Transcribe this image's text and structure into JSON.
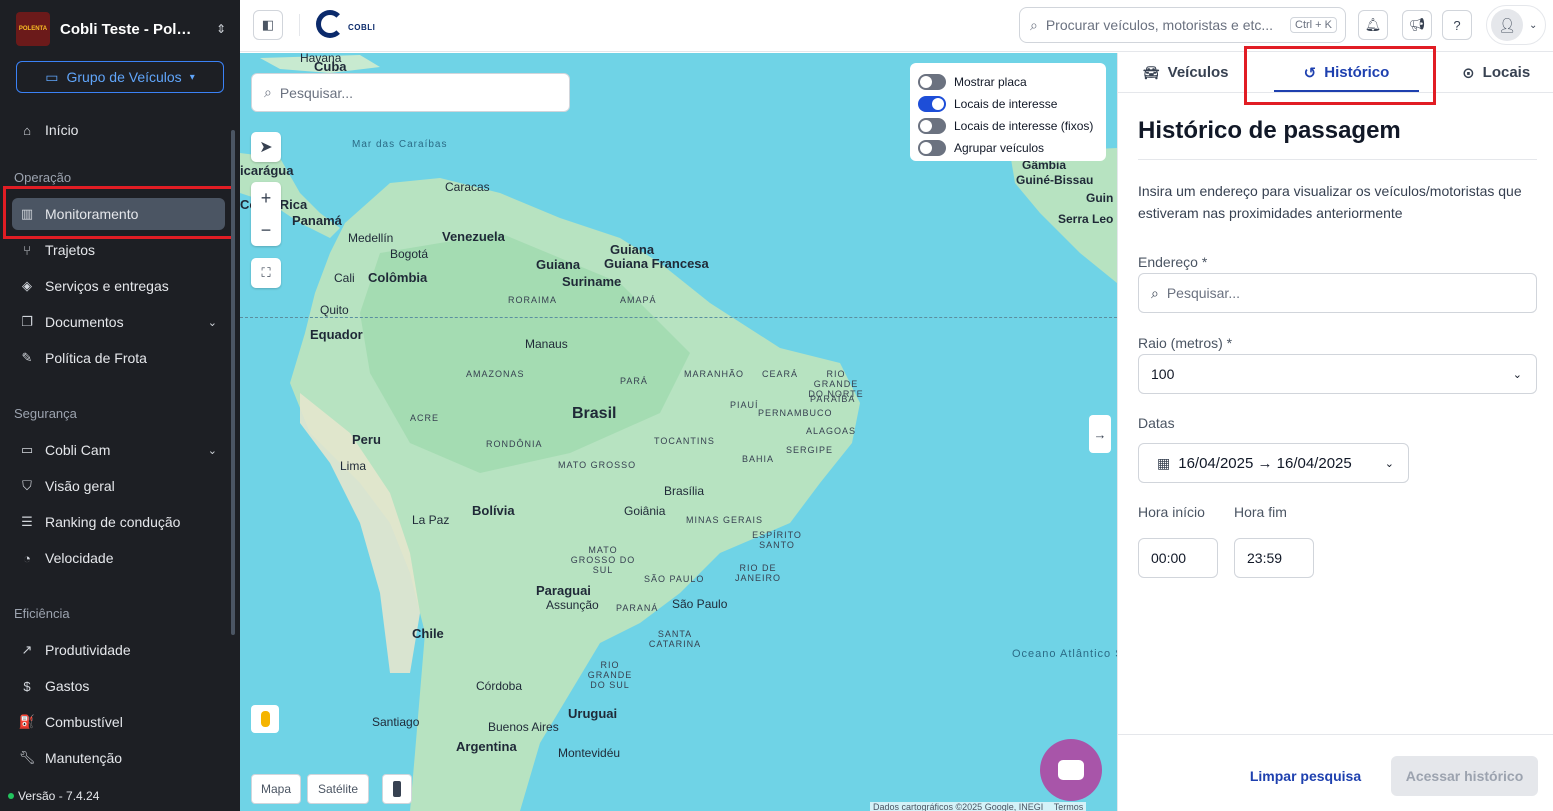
{
  "sidebar": {
    "org_logo_text": "POLENTA",
    "org_name": "Cobli Teste - Polen...",
    "group_button": "Grupo de Veículos",
    "home": "Início",
    "sections": {
      "operation": "Operação",
      "safety": "Segurança",
      "efficiency": "Eficiência"
    },
    "items": {
      "monitoring": "Monitoramento",
      "routes": "Trajetos",
      "services": "Serviços e entregas",
      "documents": "Documentos",
      "policy": "Política de Frota",
      "cam": "Cobli Cam",
      "overview": "Visão geral",
      "ranking": "Ranking de condução",
      "speed": "Velocidade",
      "productivity": "Produtividade",
      "expenses": "Gastos",
      "fuel": "Combustível",
      "maintenance": "Manutenção"
    },
    "version": "Versão - 7.4.24"
  },
  "topbar": {
    "brand": "COBLI",
    "search_placeholder": "Procurar veículos, motoristas e etc...",
    "shortcut": "Ctrl + K"
  },
  "map": {
    "search_placeholder": "Pesquisar...",
    "toggles": [
      {
        "label": "Mostrar placa",
        "on": false
      },
      {
        "label": "Locais de interesse",
        "on": true
      },
      {
        "label": "Locais de interesse (fixos)",
        "on": false
      },
      {
        "label": "Agrupar veículos",
        "on": false
      }
    ],
    "map_type_map": "Mapa",
    "map_type_satellite": "Satélite",
    "attribution": "Dados cartográficos ©2025 Google, INEGI",
    "terms": "Termos",
    "labels": {
      "havana": "Havana",
      "cuba": "Cuba",
      "caribbean": "Mar das Caraíbas",
      "nicaragua": "icarágua",
      "costa_rica": "Costa Rica",
      "panama": "Panamá",
      "caracas": "Caracas",
      "medellin": "Medellín",
      "bogota": "Bogotá",
      "venezuela": "Venezuela",
      "guiana": "Guiana",
      "french_guiana": "Guiana Francesa",
      "guiana2": "Guiana",
      "suriname": "Suriname",
      "cali": "Cali",
      "colombia": "Colômbia",
      "roraima": "RORAIMA",
      "amapa": "AMAPÁ",
      "quito": "Quito",
      "ecuador": "Equador",
      "manaus": "Manaus",
      "amazonas": "AMAZONAS",
      "para": "PARÁ",
      "maranhao": "MARANHÃO",
      "ceara": "CEARÁ",
      "rio_grande_norte": "RIO GRANDE DO NORTE",
      "paraiba": "PARAÍBA",
      "pernambuco": "PERNAMBUCO",
      "piaui": "PIAUÍ",
      "alagoas": "ALAGOAS",
      "sergipe": "SERGIPE",
      "acre": "ACRE",
      "brasil": "Brasil",
      "rondonia": "RONDÔNIA",
      "tocantins": "TOCANTINS",
      "bahia": "BAHIA",
      "peru": "Peru",
      "lima": "Lima",
      "mato_grosso": "MATO GROSSO",
      "brasilia": "Brasília",
      "goiania": "Goiânia",
      "minas": "MINAS GERAIS",
      "la_paz": "La Paz",
      "bolivia": "Bolívia",
      "espirito_santo": "ESPÍRITO SANTO",
      "ms": "MATO GROSSO DO SUL",
      "rio": "RIO DE JANEIRO",
      "sao_paulo_state": "SÃO PAULO",
      "paraguai": "Paraguai",
      "assuncao": "Assunção",
      "parana": "PARANÁ",
      "sao_paulo": "São Paulo",
      "santa_catarina": "SANTA CATARINA",
      "chile": "Chile",
      "rio_grande_sul": "RIO GRANDE DO SUL",
      "cordoba": "Córdoba",
      "santiago": "Santiago",
      "uruguai": "Uruguai",
      "buenos_aires": "Buenos Aires",
      "argentina": "Argentina",
      "montevideu": "Montevidéu",
      "ocean": "Oceano Atlântico Sul",
      "gambia": "Gâmbia",
      "guine_bissau": "Guiné-Bissau",
      "guine": "Guin",
      "serra_leoa": "Serra Leo"
    }
  },
  "panel": {
    "tabs": [
      "Veículos",
      "Histórico",
      "Locais"
    ],
    "title": "Histórico de passagem",
    "description": "Insira um endereço para visualizar os veículos/motoristas que estiveram nas proximidades anteriormente",
    "address_label": "Endereço *",
    "address_placeholder": "Pesquisar...",
    "radius_label": "Raio (metros) *",
    "radius_value": "100",
    "dates_label": "Datas",
    "dates_value": "16/04/2025 → 16/04/2025",
    "start_label": "Hora início",
    "end_label": "Hora fim",
    "start_value": "00:00",
    "end_value": "23:59",
    "clear_button": "Limpar pesquisa",
    "access_button": "Acessar histórico"
  },
  "colors": {
    "sidebar_bg": "#1d1f24",
    "accent": "#1e40af",
    "highlight_box": "#e11d24",
    "water": "#6fd3e6",
    "land": "#b7e3c1"
  }
}
